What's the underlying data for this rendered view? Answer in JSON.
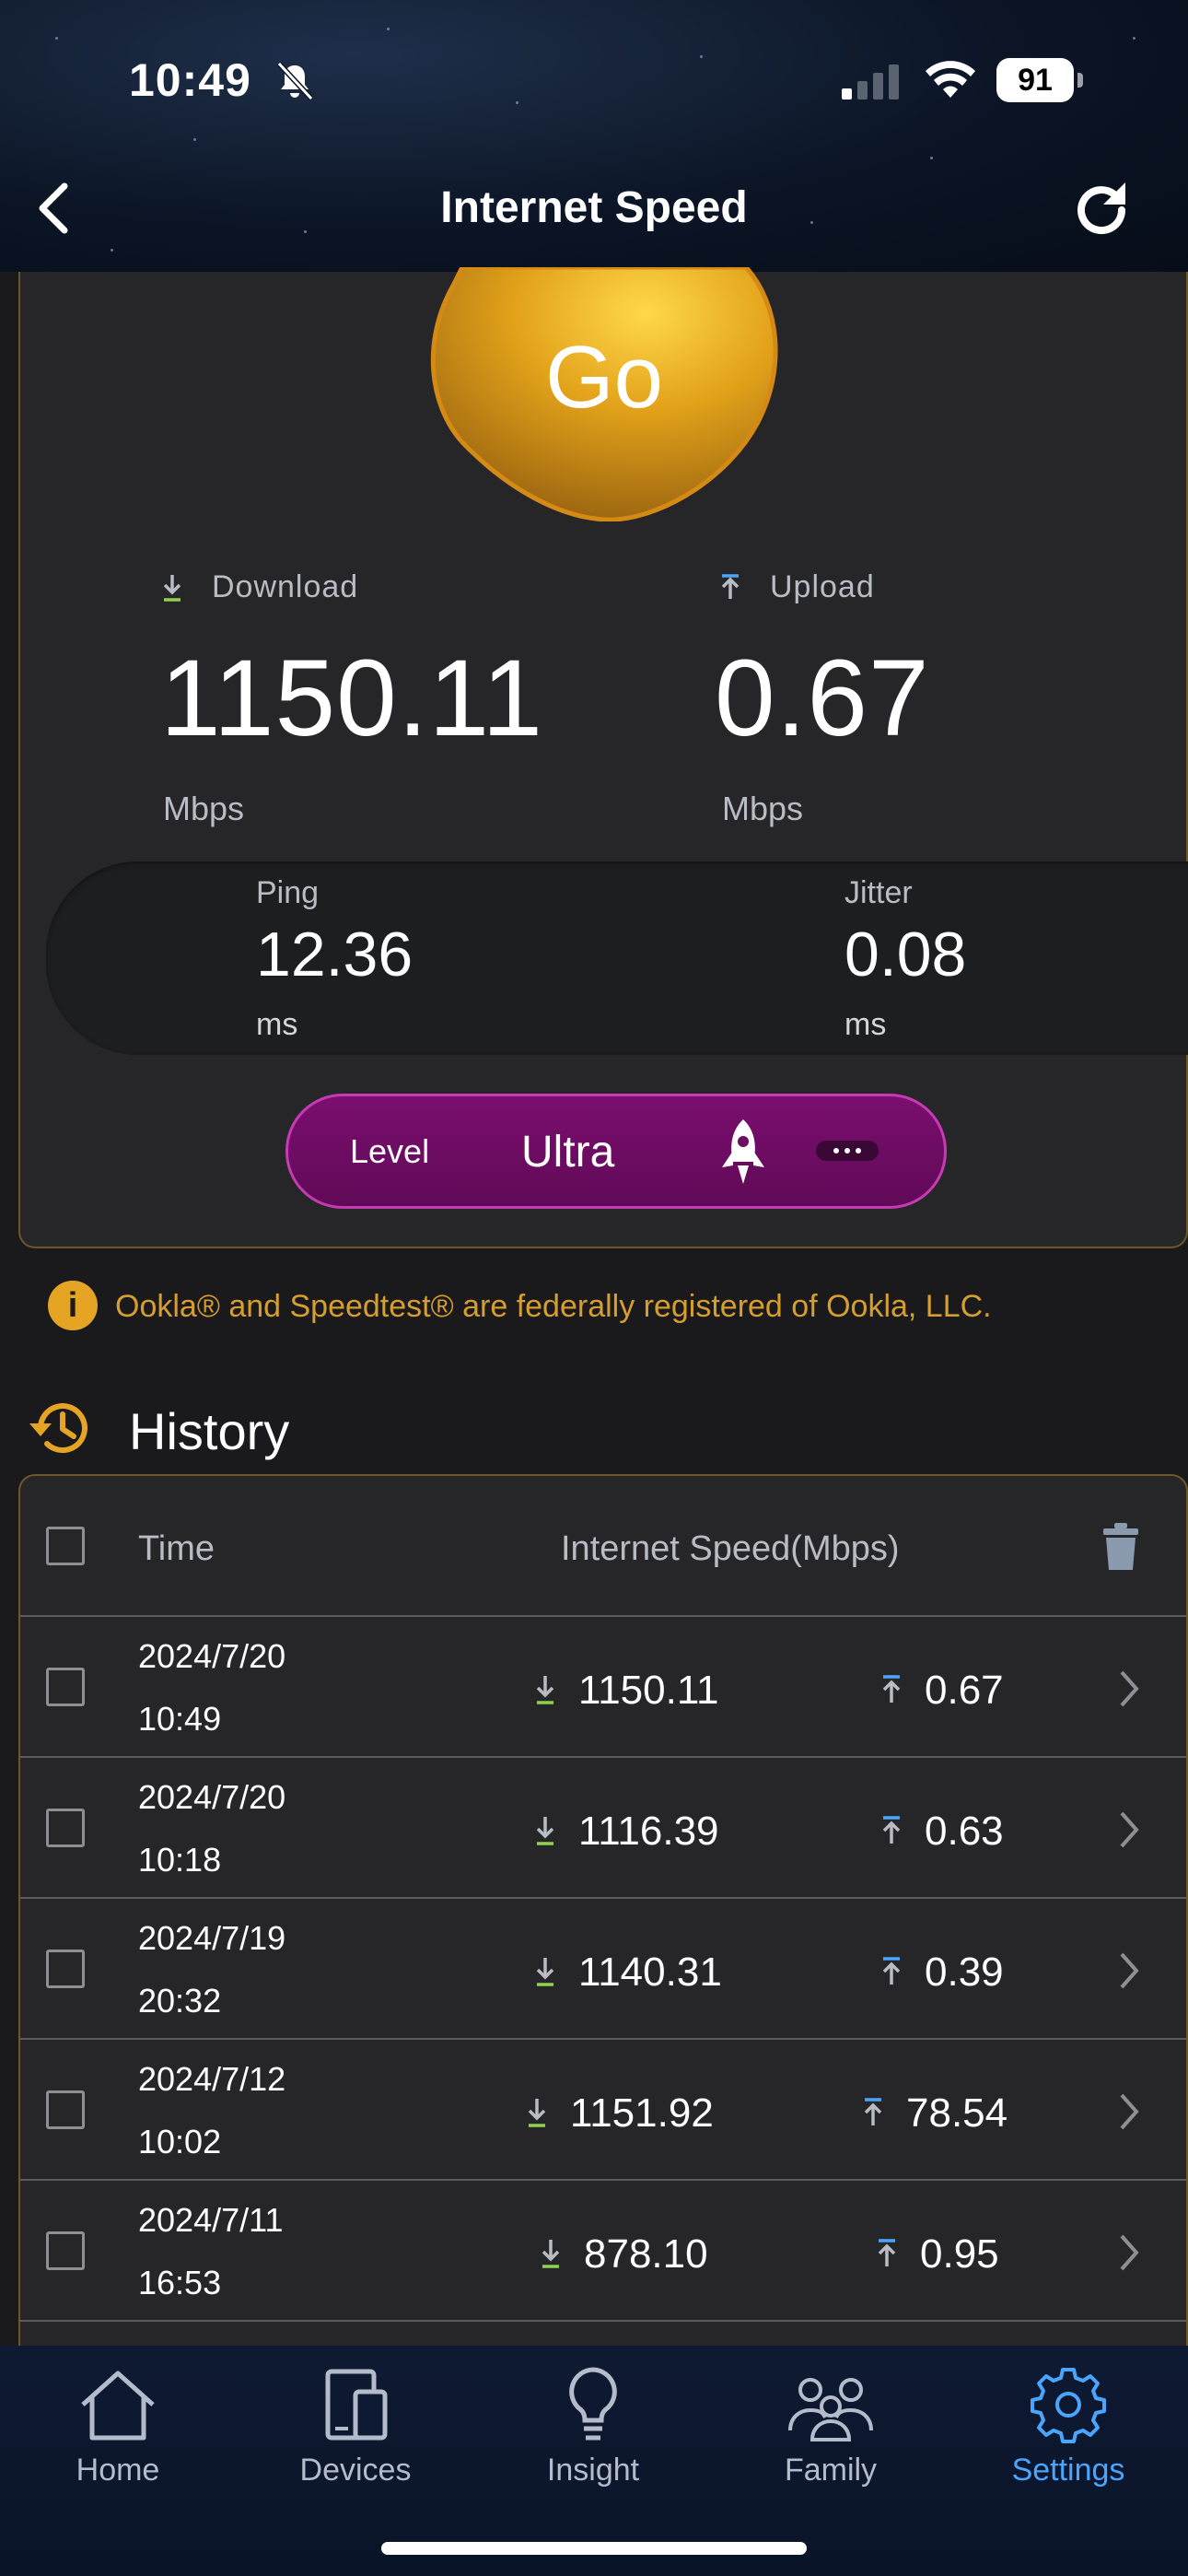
{
  "status_bar": {
    "time": "10:49",
    "battery": "91",
    "icons": [
      "bell-slash-icon",
      "cellular-signal-icon",
      "wifi-icon",
      "battery-icon"
    ]
  },
  "header": {
    "title": "Internet Speed",
    "icons": [
      "back-chevron-icon",
      "refresh-icon"
    ]
  },
  "speed_test": {
    "go_label": "Go",
    "download": {
      "label": "Download",
      "value": "1150.11",
      "unit": "Mbps"
    },
    "upload": {
      "label": "Upload",
      "value": "0.67",
      "unit": "Mbps"
    },
    "ping": {
      "label": "Ping",
      "value": "12.36",
      "unit": "ms"
    },
    "jitter": {
      "label": "Jitter",
      "value": "0.08",
      "unit": "ms"
    },
    "level": {
      "label": "Level",
      "value": "Ultra",
      "icon": "rocket-icon"
    }
  },
  "notice": "Ookla® and Speedtest® are federally registered of Ookla, LLC.",
  "history": {
    "title": "History",
    "columns": {
      "time": "Time",
      "speed": "Internet Speed(Mbps)"
    },
    "rows": [
      {
        "date": "2024/7/20",
        "time": "10:49",
        "download": "1150.11",
        "upload": "0.67"
      },
      {
        "date": "2024/7/20",
        "time": "10:18",
        "download": "1116.39",
        "upload": "0.63"
      },
      {
        "date": "2024/7/19",
        "time": "20:32",
        "download": "1140.31",
        "upload": "0.39"
      },
      {
        "date": "2024/7/12",
        "time": "10:02",
        "download": "1151.92",
        "upload": "78.54"
      },
      {
        "date": "2024/7/11",
        "time": "16:53",
        "download": "878.10",
        "upload": "0.95"
      }
    ]
  },
  "tabbar": {
    "tabs": [
      {
        "label": "Home",
        "icon": "house-icon"
      },
      {
        "label": "Devices",
        "icon": "devices-icon"
      },
      {
        "label": "Insight",
        "icon": "lightbulb-icon"
      },
      {
        "label": "Family",
        "icon": "family-icon"
      },
      {
        "label": "Settings",
        "icon": "gear-icon",
        "active": true
      }
    ]
  },
  "colors": {
    "accent_gold": "#e5a423",
    "download_green": "#8fd14f",
    "upload_blue": "#4aa5ff",
    "level_magenta": "#7b0e6f",
    "active_tab": "#4aa5ff"
  }
}
